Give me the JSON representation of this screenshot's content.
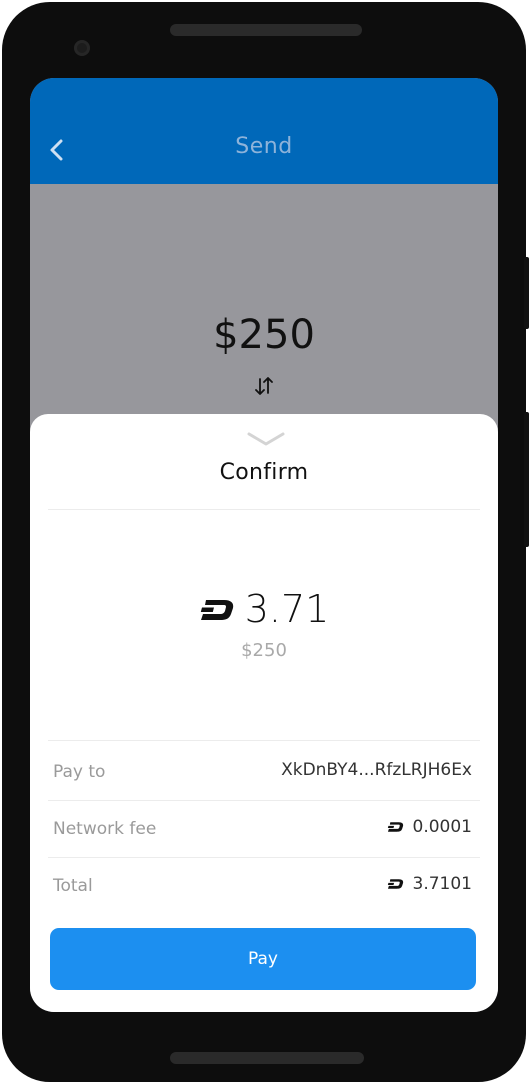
{
  "header": {
    "title": "Send",
    "back_icon": "chevron-left-icon"
  },
  "entry": {
    "amount": "$250",
    "swap_icon": "swap-vertical-icon"
  },
  "confirm": {
    "collapse_icon": "chevron-down-icon",
    "title": "Confirm",
    "crypto_icon": "dash-logo-icon",
    "crypto_amount": "3.71",
    "fiat_amount": "$250",
    "rows": [
      {
        "label": "Pay to",
        "value": "XkDnBY4...RfzLRJH6Ex",
        "icon": null
      },
      {
        "label": "Network fee",
        "value": "0.0001",
        "icon": "dash-logo-icon"
      },
      {
        "label": "Total",
        "value": "3.7101",
        "icon": "dash-logo-icon"
      }
    ],
    "pay_label": "Pay"
  },
  "colors": {
    "app_bar": "#0068b9",
    "pay_button": "#1c8ff0",
    "dim_overlay": "#97979c"
  }
}
